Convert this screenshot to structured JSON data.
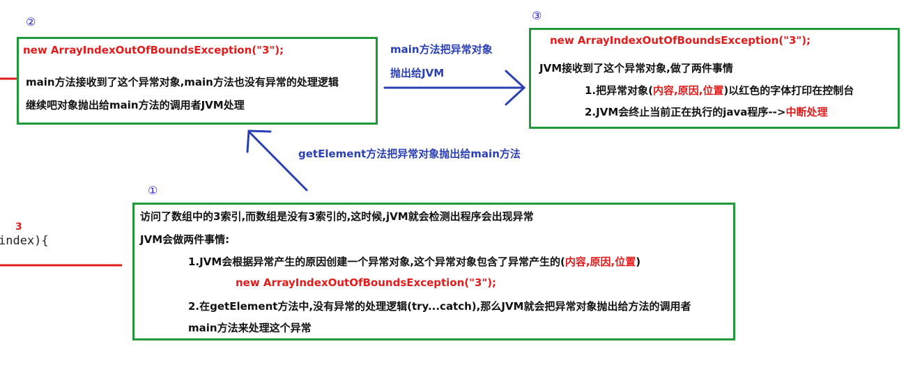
{
  "circled": {
    "one": "①",
    "two": "②",
    "three": "③"
  },
  "box2": {
    "exception": "new ArrayIndexOutOfBoundsException(\"3\");",
    "line1": "main方法接收到了这个异常对象,main方法也没有异常的处理逻辑",
    "line2": "继续吧对象抛出给main方法的调用者JVM处理"
  },
  "box3": {
    "exception": "new ArrayIndexOutOfBoundsException(\"3\");",
    "line1": "JVM接收到了这个异常对象,做了两件事情",
    "line2_a": "1.把异常对象(",
    "line2_red": "内容,原因,位置",
    "line2_b": ")以红色的字体打印在控制台",
    "line3_a": "2.JVM会终止当前正在执行的java程序-->",
    "line3_red": "中断处理"
  },
  "box1": {
    "line1": "访问了数组中的3索引,而数组是没有3索引的,这时候,jVM就会检测出程序会出现异常",
    "line2": "JVM会做两件事情:",
    "line3_a": "1.JVM会根据异常产生的原因创建一个异常对象,这个异常对象包含了异常产生的(",
    "line3_red": "内容,原因,位置",
    "line3_b": ")",
    "exception": "new ArrayIndexOutOfBoundsException(\"3\");",
    "line4": "2.在getElement方法中,没有异常的处理逻辑(try...catch),那么JVM就会把异常对象抛出给方法的调用者",
    "line5": "main方法来处理这个异常"
  },
  "arrows": {
    "main_to_jvm_1": "main方法把异常对象",
    "main_to_jvm_2": "抛出给JVM",
    "get_to_main": "getElement方法把异常对象抛出给main方法"
  },
  "code_fragment": {
    "red_index": "3",
    "text": "index){"
  },
  "colors": {
    "box_border": "#1f9a3a",
    "arrow": "#2a3fb4",
    "highlight": "#e21b1b",
    "circled_number": "#1f1fd8"
  }
}
